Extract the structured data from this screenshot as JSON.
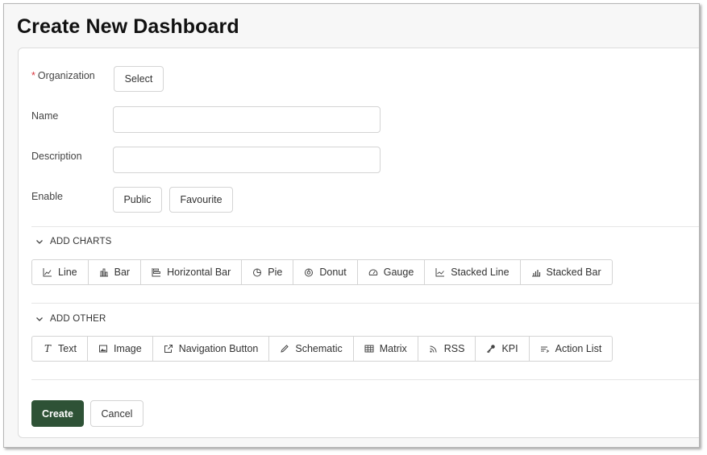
{
  "page": {
    "title": "Create New Dashboard"
  },
  "form": {
    "organization": {
      "label": "Organization",
      "required_mark": "*",
      "button": "Select"
    },
    "name": {
      "label": "Name",
      "value": "",
      "placeholder": ""
    },
    "description": {
      "label": "Description",
      "value": "",
      "placeholder": ""
    },
    "enable": {
      "label": "Enable",
      "public": "Public",
      "favourite": "Favourite"
    }
  },
  "sections": {
    "charts": {
      "title": "ADD CHARTS",
      "items": [
        {
          "label": "Line",
          "icon": "line-chart-icon"
        },
        {
          "label": "Bar",
          "icon": "bar-chart-icon"
        },
        {
          "label": "Horizontal Bar",
          "icon": "horizontal-bar-icon"
        },
        {
          "label": "Pie",
          "icon": "pie-chart-icon"
        },
        {
          "label": "Donut",
          "icon": "donut-chart-icon"
        },
        {
          "label": "Gauge",
          "icon": "gauge-icon"
        },
        {
          "label": "Stacked Line",
          "icon": "stacked-line-icon"
        },
        {
          "label": "Stacked Bar",
          "icon": "stacked-bar-icon"
        }
      ]
    },
    "other": {
      "title": "ADD OTHER",
      "items": [
        {
          "label": "Text",
          "icon": "text-icon"
        },
        {
          "label": "Image",
          "icon": "image-icon"
        },
        {
          "label": "Navigation Button",
          "icon": "external-link-icon"
        },
        {
          "label": "Schematic",
          "icon": "pencil-icon"
        },
        {
          "label": "Matrix",
          "icon": "table-icon"
        },
        {
          "label": "RSS",
          "icon": "rss-icon"
        },
        {
          "label": "KPI",
          "icon": "key-icon"
        },
        {
          "label": "Action List",
          "icon": "list-icon"
        }
      ]
    }
  },
  "actions": {
    "create": "Create",
    "cancel": "Cancel"
  },
  "colors": {
    "primary": "#2e5236",
    "required": "#d9363e",
    "border": "#d4d4d4"
  }
}
